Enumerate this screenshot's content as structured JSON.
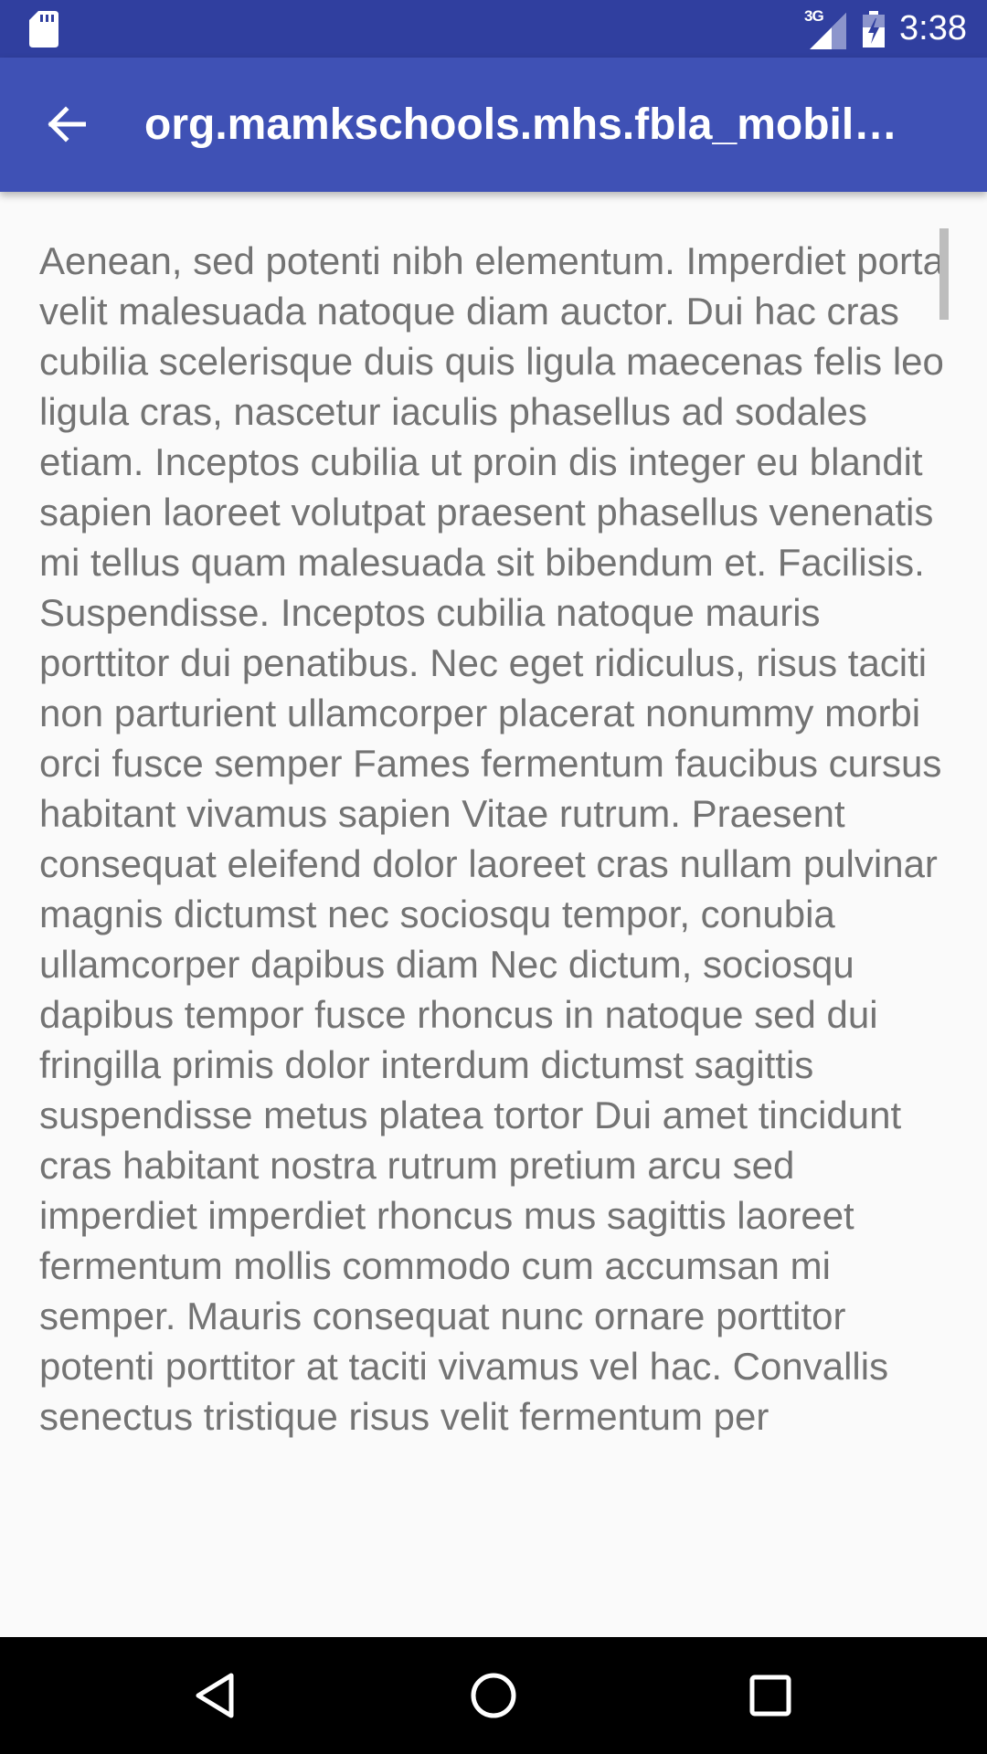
{
  "status_bar": {
    "network_type": "3G",
    "time": "3:38",
    "icons": [
      "sd-card-icon",
      "cell-signal-icon",
      "battery-charging-icon"
    ]
  },
  "app_bar": {
    "title": "org.mamkschools.mhs.fbla_mobil…",
    "back_icon": "arrow-back-icon"
  },
  "content": {
    "body": "Aenean, sed potenti nibh elementum. Imperdiet porta velit malesuada natoque diam auctor. Dui hac cras cubilia scelerisque duis quis ligula maecenas felis leo ligula cras, nascetur iaculis phasellus ad sodales etiam. Inceptos cubilia ut proin dis integer eu blandit sapien laoreet volutpat praesent phasellus venenatis mi tellus quam malesuada sit bibendum et. Facilisis. Suspendisse. Inceptos cubilia natoque mauris porttitor dui penatibus. Nec eget ridiculus, risus taciti non parturient ullamcorper placerat nonummy morbi orci fusce semper Fames fermentum faucibus cursus habitant vivamus sapien Vitae rutrum. Praesent consequat eleifend dolor laoreet cras nullam pulvinar magnis dictumst nec sociosqu tempor, conubia ullamcorper dapibus diam Nec dictum, sociosqu dapibus tempor fusce rhoncus in natoque sed dui fringilla primis dolor interdum dictumst sagittis suspendisse metus platea tortor Dui amet tincidunt cras habitant nostra rutrum pretium arcu sed imperdiet imperdiet rhoncus mus sagittis laoreet fermentum mollis commodo cum accumsan mi semper. Mauris consequat nunc ornare porttitor potenti porttitor at taciti vivamus vel hac. Convallis senectus tristique risus velit fermentum per"
  },
  "nav_bar": {
    "icons": [
      "nav-back-icon",
      "nav-home-icon",
      "nav-recents-icon"
    ]
  },
  "colors": {
    "status_bar": "#303f9f",
    "app_bar": "#3f51b5",
    "background": "#fafafa",
    "body_text": "#737373",
    "nav_bar": "#000000"
  }
}
